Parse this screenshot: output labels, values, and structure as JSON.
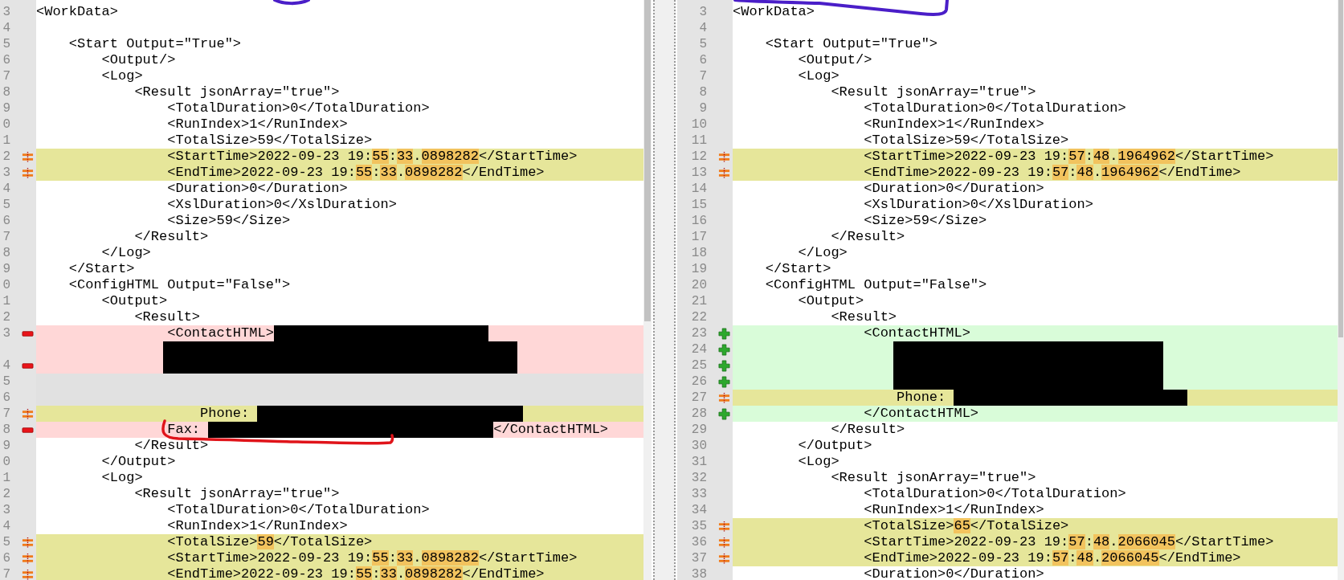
{
  "panes": [
    {
      "rows": [
        {
          "number": "3",
          "kind": "plain",
          "text": "<WorkData>"
        },
        {
          "number": "4",
          "kind": "plain"
        },
        {
          "number": "5",
          "kind": "plain",
          "text": "    <Start Output=\"True\">"
        },
        {
          "number": "6",
          "kind": "plain",
          "text": "        <Output/>"
        },
        {
          "number": "7",
          "kind": "plain",
          "text": "        <Log>"
        },
        {
          "number": "8",
          "kind": "plain",
          "text": "            <Result jsonArray=\"true\">"
        },
        {
          "number": "9",
          "kind": "plain",
          "text": "                <TotalDuration>0</TotalDuration>"
        },
        {
          "number": "0",
          "kind": "plain",
          "text": "                <RunIndex>1</RunIndex>"
        },
        {
          "number": "1",
          "kind": "plain",
          "text": "                <TotalSize>59</TotalSize>"
        },
        {
          "number": "2",
          "kind": "changed",
          "segments": [
            {
              "kind": "text",
              "text": "                <StartTime>2022-09-23 19:"
            },
            {
              "kind": "diff",
              "text": "55"
            },
            {
              "kind": "text",
              "text": ":"
            },
            {
              "kind": "diff",
              "text": "33"
            },
            {
              "kind": "text",
              "text": "."
            },
            {
              "kind": "diff",
              "text": "0898282"
            },
            {
              "kind": "text",
              "text": "</StartTime>"
            }
          ]
        },
        {
          "number": "3",
          "kind": "changed",
          "segments": [
            {
              "kind": "text",
              "text": "                <EndTime>2022-09-23 19:"
            },
            {
              "kind": "diff",
              "text": "55"
            },
            {
              "kind": "text",
              "text": ":"
            },
            {
              "kind": "diff",
              "text": "33"
            },
            {
              "kind": "text",
              "text": "."
            },
            {
              "kind": "diff",
              "text": "0898282"
            },
            {
              "kind": "text",
              "text": "</EndTime>"
            }
          ]
        },
        {
          "number": "4",
          "kind": "plain",
          "text": "                <Duration>0</Duration>"
        },
        {
          "number": "5",
          "kind": "plain",
          "text": "                <XslDuration>0</XslDuration>"
        },
        {
          "number": "6",
          "kind": "plain",
          "text": "                <Size>59</Size>"
        },
        {
          "number": "7",
          "kind": "plain",
          "text": "            </Result>"
        },
        {
          "number": "8",
          "kind": "plain",
          "text": "        </Log>"
        },
        {
          "number": "9",
          "kind": "plain",
          "text": "    </Start>"
        },
        {
          "number": "0",
          "kind": "plain",
          "text": "    <ConfigHTML Output=\"False\">"
        },
        {
          "number": "1",
          "kind": "plain",
          "text": "        <Output>"
        },
        {
          "number": "2",
          "kind": "plain",
          "text": "            <Result>"
        },
        {
          "number": "3",
          "kind": "removed",
          "segments": [
            {
              "kind": "text",
              "text": "                <ContactHTML>"
            },
            {
              "kind": "redacted"
            }
          ]
        },
        {
          "kind": "removed",
          "segments": [
            {
              "kind": "redacted"
            }
          ]
        },
        {
          "number": "4",
          "kind": "removed",
          "segments": [
            {
              "kind": "redacted"
            }
          ]
        },
        {
          "number": "5",
          "kind": "filler"
        },
        {
          "number": "6",
          "kind": "filler"
        },
        {
          "number": "7",
          "kind": "changed",
          "segments": [
            {
              "kind": "text",
              "text": "                    Phone: "
            },
            {
              "kind": "redacted"
            }
          ]
        },
        {
          "number": "8",
          "kind": "removed",
          "segments": [
            {
              "kind": "text",
              "text": "                Fax: "
            },
            {
              "kind": "redacted"
            },
            {
              "kind": "text",
              "text": "</ContactHTML>"
            }
          ]
        },
        {
          "number": "9",
          "kind": "plain",
          "text": "            </Result>"
        },
        {
          "number": "0",
          "kind": "plain",
          "text": "        </Output>"
        },
        {
          "number": "1",
          "kind": "plain",
          "text": "        <Log>"
        },
        {
          "number": "2",
          "kind": "plain",
          "text": "            <Result jsonArray=\"true\">"
        },
        {
          "number": "3",
          "kind": "plain",
          "text": "                <TotalDuration>0</TotalDuration>"
        },
        {
          "number": "4",
          "kind": "plain",
          "text": "                <RunIndex>1</RunIndex>"
        },
        {
          "number": "5",
          "kind": "changed",
          "segments": [
            {
              "kind": "text",
              "text": "                <TotalSize>"
            },
            {
              "kind": "diff",
              "text": "59"
            },
            {
              "kind": "text",
              "text": "</TotalSize>"
            }
          ]
        },
        {
          "number": "6",
          "kind": "changed",
          "segments": [
            {
              "kind": "text",
              "text": "                <StartTime>2022-09-23 19:"
            },
            {
              "kind": "diff",
              "text": "55"
            },
            {
              "kind": "text",
              "text": ":"
            },
            {
              "kind": "diff",
              "text": "33"
            },
            {
              "kind": "text",
              "text": "."
            },
            {
              "kind": "diff",
              "text": "0898282"
            },
            {
              "kind": "text",
              "text": "</StartTime>"
            }
          ]
        },
        {
          "number": "7",
          "kind": "changed",
          "segments": [
            {
              "kind": "text",
              "text": "                <EndTime>2022-09-23 19:"
            },
            {
              "kind": "diff",
              "text": "55"
            },
            {
              "kind": "text",
              "text": ":"
            },
            {
              "kind": "diff",
              "text": "33"
            },
            {
              "kind": "text",
              "text": "."
            },
            {
              "kind": "diff",
              "text": "0898282"
            },
            {
              "kind": "text",
              "text": "</EndTime>"
            }
          ]
        }
      ]
    },
    {
      "rows": [
        {
          "number": "3",
          "kind": "plain",
          "text": "<WorkData>"
        },
        {
          "number": "4",
          "kind": "plain"
        },
        {
          "number": "5",
          "kind": "plain",
          "text": "    <Start Output=\"True\">"
        },
        {
          "number": "6",
          "kind": "plain",
          "text": "        <Output/>"
        },
        {
          "number": "7",
          "kind": "plain",
          "text": "        <Log>"
        },
        {
          "number": "8",
          "kind": "plain",
          "text": "            <Result jsonArray=\"true\">"
        },
        {
          "number": "9",
          "kind": "plain",
          "text": "                <TotalDuration>0</TotalDuration>"
        },
        {
          "number": "10",
          "kind": "plain",
          "text": "                <RunIndex>1</RunIndex>"
        },
        {
          "number": "11",
          "kind": "plain",
          "text": "                <TotalSize>59</TotalSize>"
        },
        {
          "number": "12",
          "kind": "changed",
          "segments": [
            {
              "kind": "text",
              "text": "                <StartTime>2022-09-23 19:"
            },
            {
              "kind": "diff",
              "text": "57"
            },
            {
              "kind": "text",
              "text": ":"
            },
            {
              "kind": "diff",
              "text": "48"
            },
            {
              "kind": "text",
              "text": "."
            },
            {
              "kind": "diff",
              "text": "1964962"
            },
            {
              "kind": "text",
              "text": "</StartTime>"
            }
          ]
        },
        {
          "number": "13",
          "kind": "changed",
          "segments": [
            {
              "kind": "text",
              "text": "                <EndTime>2022-09-23 19:"
            },
            {
              "kind": "diff",
              "text": "57"
            },
            {
              "kind": "text",
              "text": ":"
            },
            {
              "kind": "diff",
              "text": "48"
            },
            {
              "kind": "text",
              "text": "."
            },
            {
              "kind": "diff",
              "text": "1964962"
            },
            {
              "kind": "text",
              "text": "</EndTime>"
            }
          ]
        },
        {
          "number": "14",
          "kind": "plain",
          "text": "                <Duration>0</Duration>"
        },
        {
          "number": "15",
          "kind": "plain",
          "text": "                <XslDuration>0</XslDuration>"
        },
        {
          "number": "16",
          "kind": "plain",
          "text": "                <Size>59</Size>"
        },
        {
          "number": "17",
          "kind": "plain",
          "text": "            </Result>"
        },
        {
          "number": "18",
          "kind": "plain",
          "text": "        </Log>"
        },
        {
          "number": "19",
          "kind": "plain",
          "text": "    </Start>"
        },
        {
          "number": "20",
          "kind": "plain",
          "text": "    <ConfigHTML Output=\"False\">"
        },
        {
          "number": "21",
          "kind": "plain",
          "text": "        <Output>"
        },
        {
          "number": "22",
          "kind": "plain",
          "text": "            <Result>"
        },
        {
          "number": "23",
          "kind": "added",
          "text": "                <ContactHTML>"
        },
        {
          "number": "24",
          "kind": "added",
          "segments": [
            {
              "kind": "redacted"
            }
          ]
        },
        {
          "number": "25",
          "kind": "added",
          "segments": [
            {
              "kind": "redacted"
            }
          ]
        },
        {
          "number": "26",
          "kind": "added",
          "segments": [
            {
              "kind": "redacted"
            }
          ]
        },
        {
          "number": "27",
          "kind": "changed",
          "segments": [
            {
              "kind": "text",
              "text": "                    Phone: "
            },
            {
              "kind": "redacted"
            }
          ]
        },
        {
          "number": "28",
          "kind": "added",
          "text": "                </ContactHTML>"
        },
        {
          "number": "29",
          "kind": "plain",
          "text": "            </Result>"
        },
        {
          "number": "30",
          "kind": "plain",
          "text": "        </Output>"
        },
        {
          "number": "31",
          "kind": "plain",
          "text": "        <Log>"
        },
        {
          "number": "32",
          "kind": "plain",
          "text": "            <Result jsonArray=\"true\">"
        },
        {
          "number": "33",
          "kind": "plain",
          "text": "                <TotalDuration>0</TotalDuration>"
        },
        {
          "number": "34",
          "kind": "plain",
          "text": "                <RunIndex>1</RunIndex>"
        },
        {
          "number": "35",
          "kind": "changed",
          "segments": [
            {
              "kind": "text",
              "text": "                <TotalSize>"
            },
            {
              "kind": "diff",
              "text": "65"
            },
            {
              "kind": "text",
              "text": "</TotalSize>"
            }
          ]
        },
        {
          "number": "36",
          "kind": "changed",
          "segments": [
            {
              "kind": "text",
              "text": "                <StartTime>2022-09-23 19:"
            },
            {
              "kind": "diff",
              "text": "57"
            },
            {
              "kind": "text",
              "text": ":"
            },
            {
              "kind": "diff",
              "text": "48"
            },
            {
              "kind": "text",
              "text": "."
            },
            {
              "kind": "diff",
              "text": "2066045"
            },
            {
              "kind": "text",
              "text": "</StartTime>"
            }
          ]
        },
        {
          "number": "37",
          "kind": "changed",
          "segments": [
            {
              "kind": "text",
              "text": "                <EndTime>2022-09-23 19:"
            },
            {
              "kind": "diff",
              "text": "57"
            },
            {
              "kind": "text",
              "text": ":"
            },
            {
              "kind": "diff",
              "text": "48"
            },
            {
              "kind": "text",
              "text": "."
            },
            {
              "kind": "diff",
              "text": "2066045"
            },
            {
              "kind": "text",
              "text": "</EndTime>"
            }
          ]
        },
        {
          "number": "38",
          "kind": "plain",
          "text": "                <Duration>0</Duration>"
        }
      ]
    }
  ]
}
